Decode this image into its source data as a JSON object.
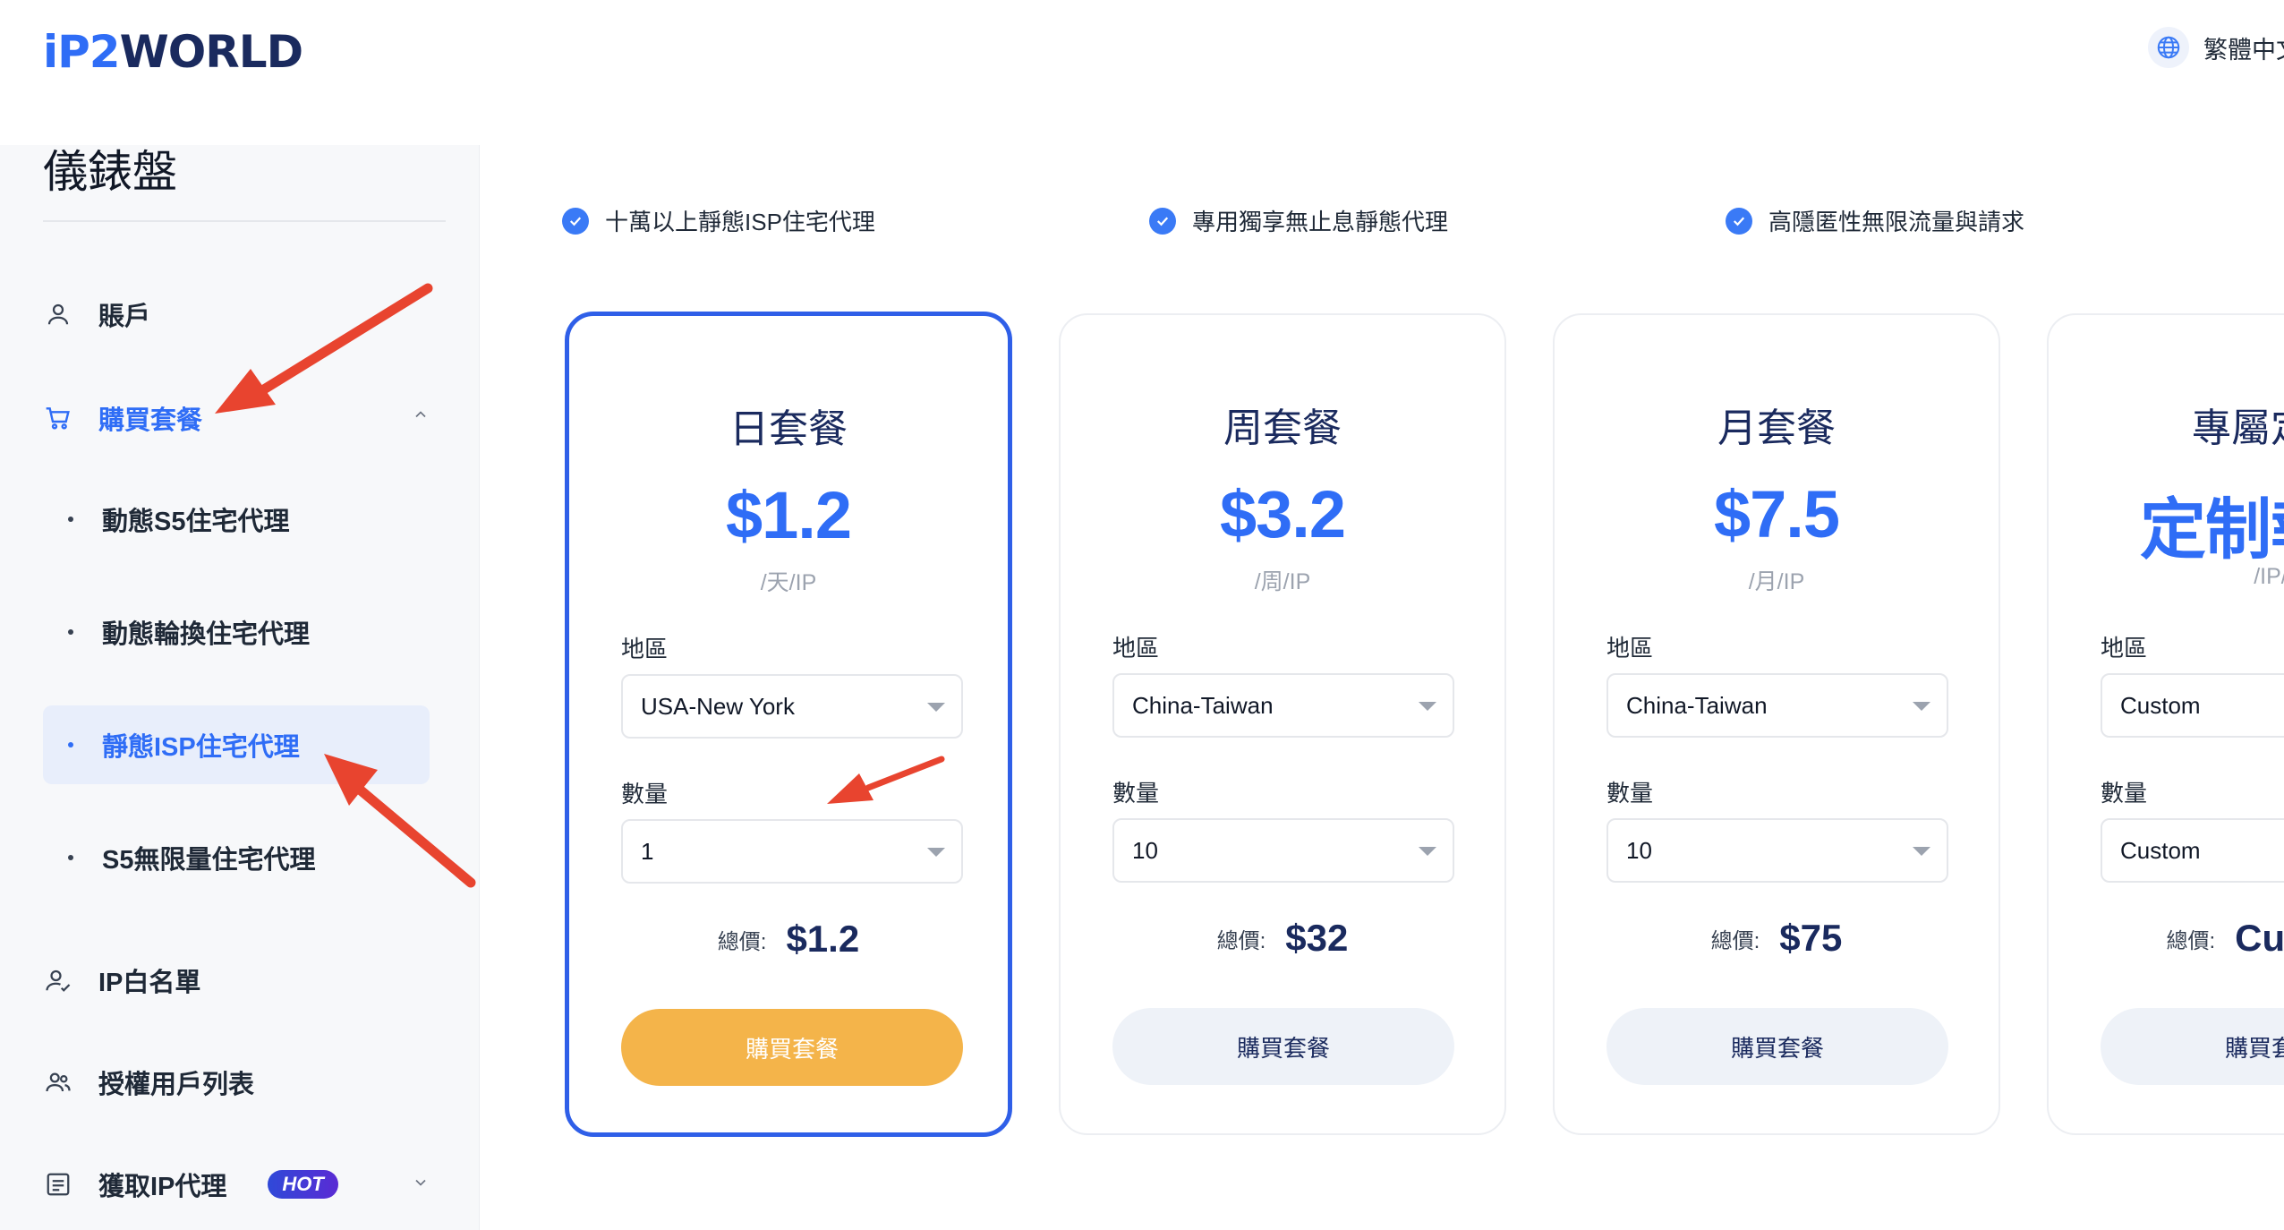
{
  "header": {
    "logo": {
      "ip": "iP",
      "two": "2",
      "world": "WORLD"
    },
    "language": "繁體中文"
  },
  "sidebar": {
    "title": "儀錶盤",
    "items": [
      {
        "label": "賬戶",
        "icon": "user-icon"
      },
      {
        "label": "購買套餐",
        "icon": "cart-icon",
        "active": true
      },
      {
        "label": "IP白名單",
        "icon": "user-check-icon"
      },
      {
        "label": "授權用戶列表",
        "icon": "users-icon"
      },
      {
        "label": "獲取IP代理",
        "icon": "list-icon",
        "badge": "HOT"
      }
    ],
    "sub_items": [
      {
        "label": "動態S5住宅代理"
      },
      {
        "label": "動態輪換住宅代理"
      },
      {
        "label": "靜態ISP住宅代理",
        "active": true
      },
      {
        "label": "S5無限量住宅代理"
      }
    ]
  },
  "features": [
    "十萬以上靜態ISP住宅代理",
    "專用獨享無止息靜態代理",
    "高隱匿性無限流量與請求"
  ],
  "plans": [
    {
      "title": "日套餐",
      "price": "$1.2",
      "unit": "/天/IP",
      "region_label": "地區",
      "region": "USA-New York",
      "qty_label": "數量",
      "qty": "1",
      "total_label": "總價:",
      "total": "$1.2",
      "button": "購買套餐",
      "selected": true
    },
    {
      "title": "周套餐",
      "price": "$3.2",
      "unit": "/周/IP",
      "region_label": "地區",
      "region": "China-Taiwan",
      "qty_label": "數量",
      "qty": "10",
      "total_label": "總價:",
      "total": "$32",
      "button": "購買套餐"
    },
    {
      "title": "月套餐",
      "price": "$7.5",
      "unit": "/月/IP",
      "region_label": "地區",
      "region": "China-Taiwan",
      "qty_label": "數量",
      "qty": "10",
      "total_label": "總價:",
      "total": "$75",
      "button": "購買套餐"
    },
    {
      "title": "專屬定制",
      "price": "定制報價",
      "unit": "/IP/",
      "region_label": "地區",
      "region": "Custom",
      "qty_label": "數量",
      "qty": "Custom",
      "total_label": "總價:",
      "total": "Custom",
      "button": "購買套餐"
    }
  ],
  "colors": {
    "accent": "#2f6df6",
    "button_primary": "#f4b44a",
    "annotation_arrow": "#e8442f"
  }
}
